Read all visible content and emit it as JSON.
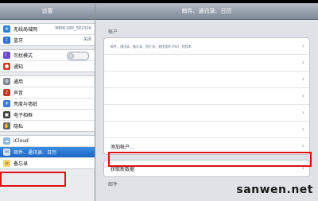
{
  "left_panel": {
    "title": "设置",
    "items": [
      {
        "label": "无线局域网",
        "value": "MERCURY_5E2326",
        "icon": "wifi-icon"
      },
      {
        "label": "蓝牙",
        "value": "关闭",
        "icon": "bluetooth-icon"
      },
      {
        "label": "勿扰模式",
        "toggle": "off",
        "icon": "moon-icon"
      },
      {
        "label": "通知",
        "icon": "notifications-icon"
      },
      {
        "label": "通用",
        "icon": "gear-icon"
      },
      {
        "label": "声音",
        "icon": "sound-icon"
      },
      {
        "label": "亮度与墙纸",
        "icon": "brightness-icon"
      },
      {
        "label": "电子相框",
        "icon": "frame-icon"
      },
      {
        "label": "隐私",
        "icon": "hand-icon"
      },
      {
        "label": "iCloud",
        "icon": "cloud-icon"
      },
      {
        "label": "邮件、通讯录、日历",
        "icon": "mail-icon",
        "selected": true
      },
      {
        "label": "备忘录",
        "icon": "notes-icon"
      }
    ]
  },
  "right_panel": {
    "title": "邮件、通讯录、日历",
    "accounts_header": "帐户",
    "accounts_row_detail": "邮件、通讯录、备忘录、照片流、查找我的 iPad、钥匙串",
    "add_account": "添加帐户…",
    "fetch_new_data": "获取新数据",
    "mail_header": "邮件"
  },
  "watermark": "sanwen.net",
  "colors": {
    "highlight_red": "#e01010",
    "selected_blue": "#1c63c6"
  }
}
